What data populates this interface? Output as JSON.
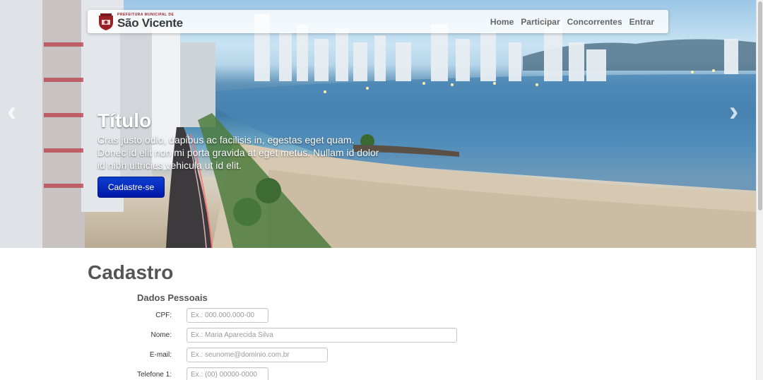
{
  "header": {
    "brand_small": "PREFEITURA MUNICIPAL DE",
    "brand_name": "São Vicente",
    "nav": [
      "Home",
      "Participar",
      "Concorrentes",
      "Entrar"
    ]
  },
  "carousel": {
    "title": "Título",
    "text": "Cras justo odio, dapibus ac facilisis in, egestas eget quam. Donec id elit non mi porta gravida at eget metus. Nullam id dolor id nibh ultricies vehicula ut id elit.",
    "cta_label": "Cadastre-se",
    "prev_icon": "chevron-left-icon",
    "next_icon": "chevron-right-icon"
  },
  "form": {
    "title": "Cadastro",
    "section": "Dados Pessoais",
    "fields": {
      "cpf": {
        "label": "CPF:",
        "placeholder": "Ex.: 000.000.000-00"
      },
      "nome": {
        "label": "Nome:",
        "placeholder": "Ex.: Maria Aparecida Silva"
      },
      "email": {
        "label": "E-mail:",
        "placeholder": "Ex.: seunome@dominio.com.br"
      },
      "telefone1": {
        "label": "Telefone 1:",
        "placeholder": "Ex.: (00) 00000-0000"
      }
    }
  },
  "colors": {
    "cta": "#0018a8",
    "brand_red": "#9b2128",
    "nav_text": "#666666"
  }
}
